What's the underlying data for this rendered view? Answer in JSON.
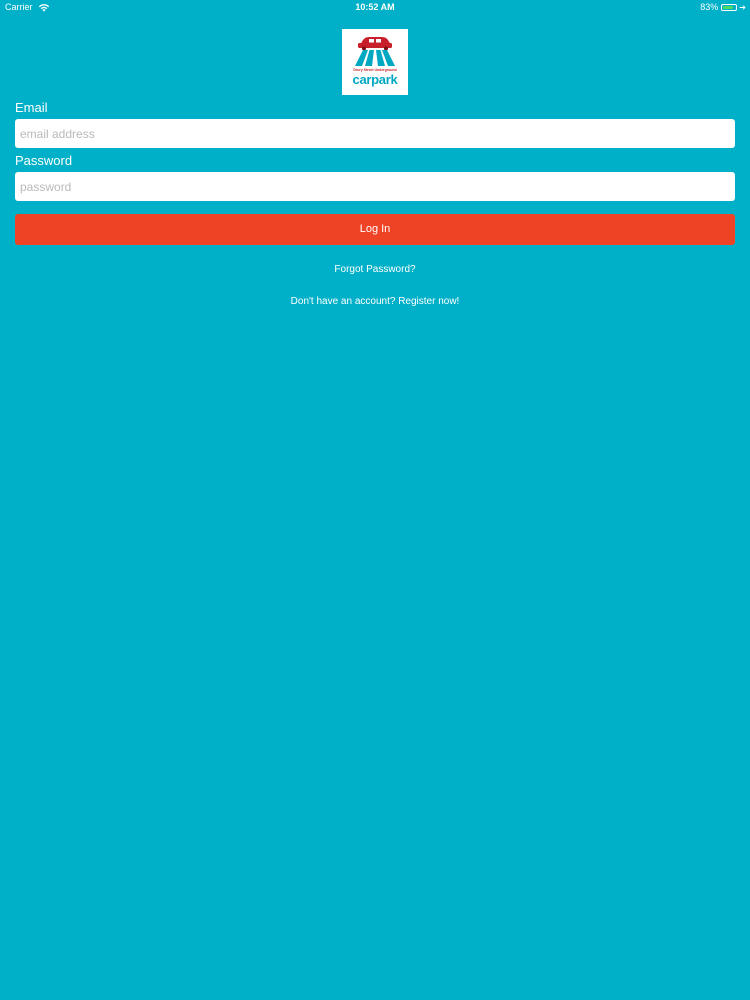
{
  "status_bar": {
    "carrier": "Carrier",
    "time": "10:52 AM",
    "battery_percent_label": "83%",
    "battery_level": 0.83,
    "icons": [
      "wifi-icon",
      "battery-icon",
      "charging-icon"
    ]
  },
  "logo": {
    "tagline": "Drury Street Underground",
    "wordmark": "carpark",
    "colors": {
      "red": "#c8202a",
      "teal": "#00a8c2"
    }
  },
  "form": {
    "email_label": "Email",
    "email_placeholder": "email address",
    "email_value": "",
    "password_label": "Password",
    "password_placeholder": "password",
    "password_value": "",
    "login_label": "Log In"
  },
  "links": {
    "forgot_password": "Forgot Password?",
    "register": "Don't have an account? Register now!"
  },
  "colors": {
    "background": "#00b0c8",
    "button": "#ef4326",
    "input_background": "#ffffff"
  }
}
